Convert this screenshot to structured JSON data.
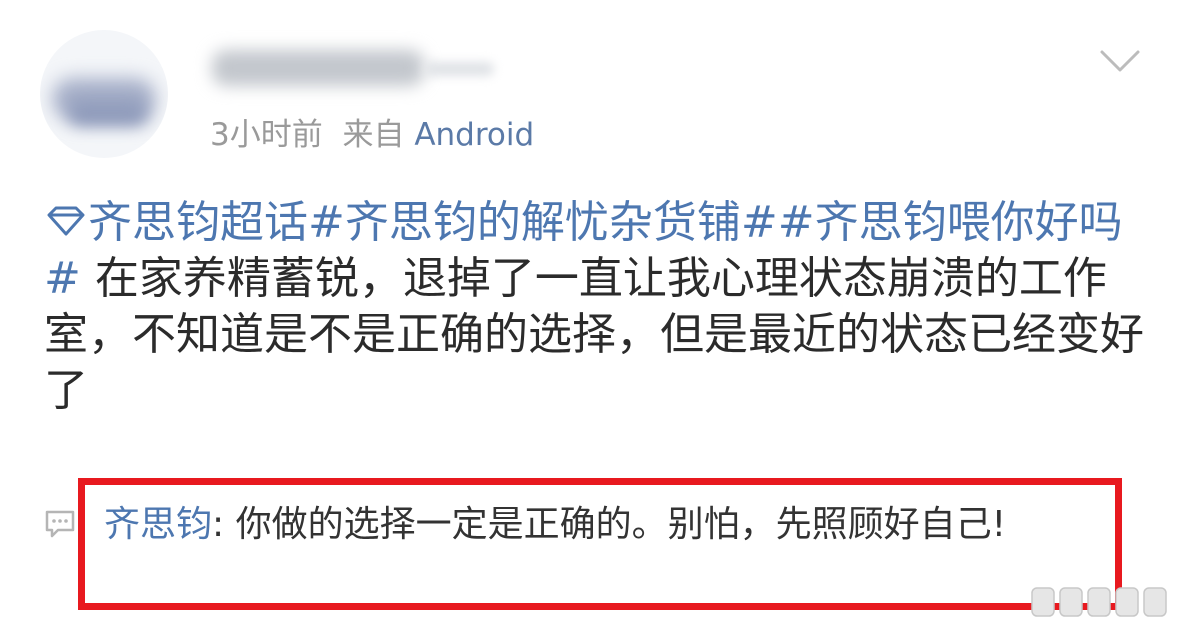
{
  "post": {
    "meta": {
      "time": "3小时前",
      "from_label": "来自",
      "source": "Android"
    },
    "tags": [
      "齐思钧超话",
      "#齐思钧的解忧杂货铺#",
      "#齐思钧喂你好吗#"
    ],
    "body": " 在家养精蓄锐，退掉了一直让我心理状态崩溃的工作室，不知道是不是正确的选择，但是最近的状态已经变好了"
  },
  "comment": {
    "author": "齐思钧",
    "separator": ": ",
    "text": "你做的选择一定是正确的。别怕，先照顾好自己!"
  },
  "colors": {
    "link": "#4d77b0",
    "meta_gray": "#9a9a9a",
    "source": "#5b7aa7",
    "highlight": "#e8191f",
    "body_text": "#2b2b2b"
  },
  "icons": {
    "chevron": "chevron-down-icon",
    "supertopic": "diamond-icon",
    "comment": "comment-bubble-icon"
  }
}
